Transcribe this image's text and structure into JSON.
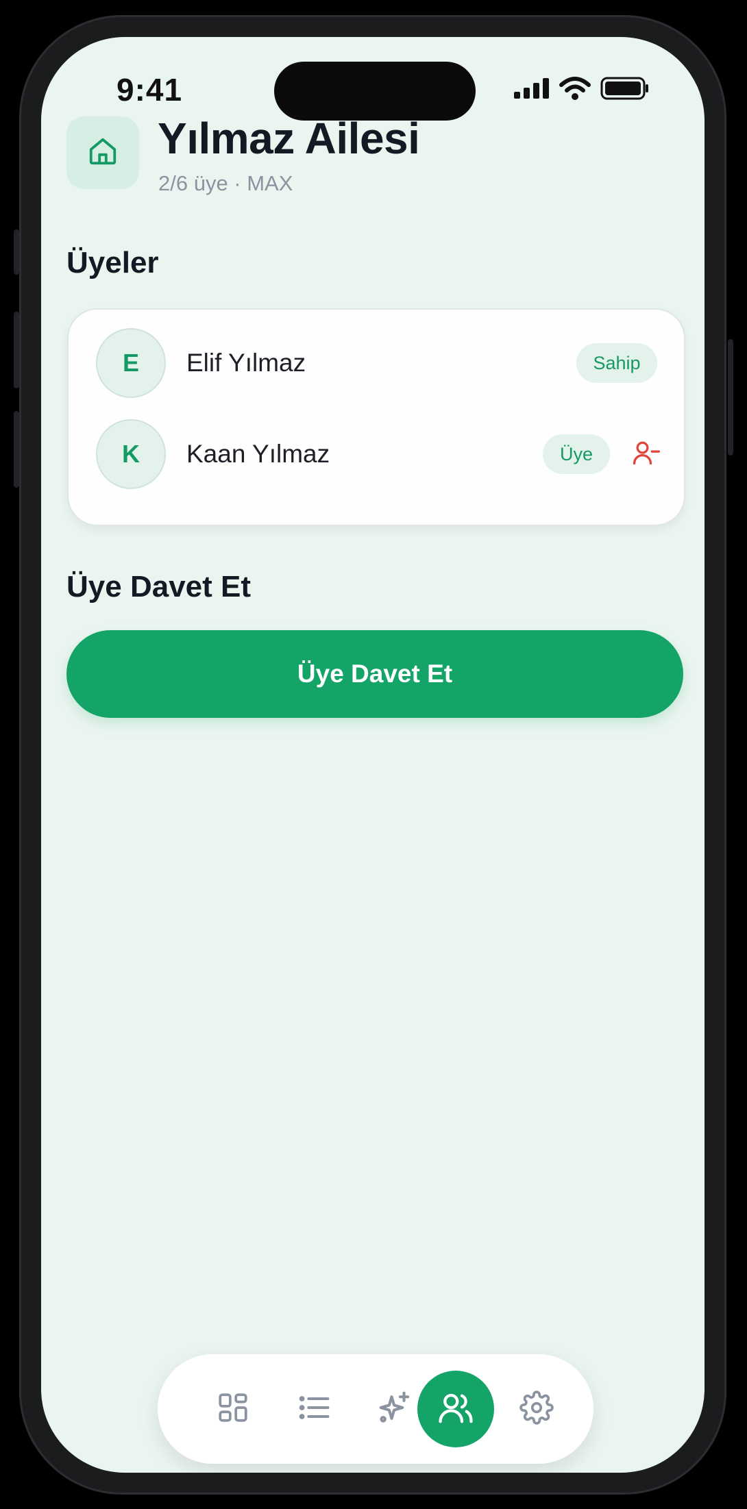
{
  "status_bar": {
    "time": "9:41"
  },
  "header": {
    "title": "Yılmaz Ailesi",
    "subtitle": "2/6 üye · MAX",
    "icon": "home-icon"
  },
  "members_section": {
    "heading": "Üyeler",
    "members": [
      {
        "initial": "E",
        "name": "Elif Yılmaz",
        "role": "Sahip",
        "removable": false
      },
      {
        "initial": "K",
        "name": "Kaan Yılmaz",
        "role": "Üye",
        "removable": true
      }
    ]
  },
  "invite_section": {
    "heading": "Üye Davet Et",
    "button_label": "Üye Davet Et"
  },
  "tab_bar": {
    "tabs": [
      {
        "icon": "dashboard-grid-icon",
        "active": false
      },
      {
        "icon": "list-icon",
        "active": false
      },
      {
        "icon": "sparkle-add-icon",
        "active": false
      },
      {
        "icon": "users-icon",
        "active": true
      },
      {
        "icon": "gear-icon",
        "active": false
      }
    ]
  },
  "colors": {
    "accent": "#15a468",
    "background": "#ebf5f0",
    "danger": "#e0463c",
    "title": "#141a24",
    "muted": "#8c93a0"
  }
}
